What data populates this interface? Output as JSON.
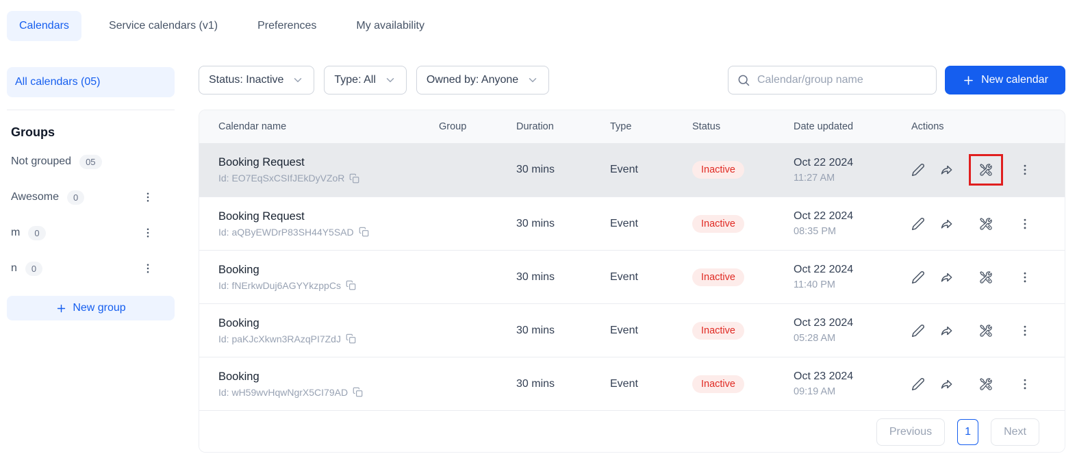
{
  "colors": {
    "accent": "#155eef",
    "accent_light_bg": "#eef4ff",
    "status_inactive_text": "#e02a23",
    "status_inactive_bg": "#fdecea",
    "highlight_box_red": "#e01f1f",
    "row_highlight_bg": "#e8eaed"
  },
  "nav": {
    "tabs": [
      {
        "label": "Calendars"
      },
      {
        "label": "Service calendars (v1)"
      },
      {
        "label": "Preferences"
      },
      {
        "label": "My availability"
      }
    ]
  },
  "sidebar": {
    "all_calendars_label": "All calendars (05)",
    "groups_heading": "Groups",
    "groups": [
      {
        "name": "Not grouped",
        "count": "05"
      },
      {
        "name": "Awesome",
        "count": "0"
      },
      {
        "name": "m",
        "count": "0"
      },
      {
        "name": "n",
        "count": "0"
      }
    ],
    "new_group_label": "New group"
  },
  "toolbar": {
    "filters": [
      {
        "label": "Status: Inactive"
      },
      {
        "label": "Type: All"
      },
      {
        "label": "Owned by: Anyone"
      }
    ],
    "search_placeholder": "Calendar/group name",
    "new_calendar_label": "New calendar"
  },
  "table": {
    "headers": [
      "Calendar name",
      "Group",
      "Duration",
      "Type",
      "Status",
      "Date updated",
      "Actions"
    ],
    "rows": [
      {
        "name": "Booking Request",
        "id": "Id: EO7EqSxCSIfJEkDyVZoR",
        "group": "",
        "duration": "30 mins",
        "type": "Event",
        "status": "Inactive",
        "date": "Oct 22 2024",
        "time": "11:27 AM"
      },
      {
        "name": "Booking Request",
        "id": "Id: aQByEWDrP83SH44Y5SAD",
        "group": "",
        "duration": "30 mins",
        "type": "Event",
        "status": "Inactive",
        "date": "Oct 22 2024",
        "time": "08:35 PM"
      },
      {
        "name": "Booking",
        "id": "Id: fNErkwDuj6AGYYkzppCs",
        "group": "",
        "duration": "30 mins",
        "type": "Event",
        "status": "Inactive",
        "date": "Oct 22 2024",
        "time": "11:40 PM"
      },
      {
        "name": "Booking",
        "id": "Id: paKJcXkwn3RAzqPI7ZdJ",
        "group": "",
        "duration": "30 mins",
        "type": "Event",
        "status": "Inactive",
        "date": "Oct 23 2024",
        "time": "05:28 AM"
      },
      {
        "name": "Booking",
        "id": "Id: wH59wvHqwNgrX5CI79AD",
        "group": "",
        "duration": "30 mins",
        "type": "Event",
        "status": "Inactive",
        "date": "Oct 23 2024",
        "time": "09:19 AM"
      }
    ]
  },
  "pagination": {
    "previous_label": "Previous",
    "page": "1",
    "next_label": "Next"
  }
}
